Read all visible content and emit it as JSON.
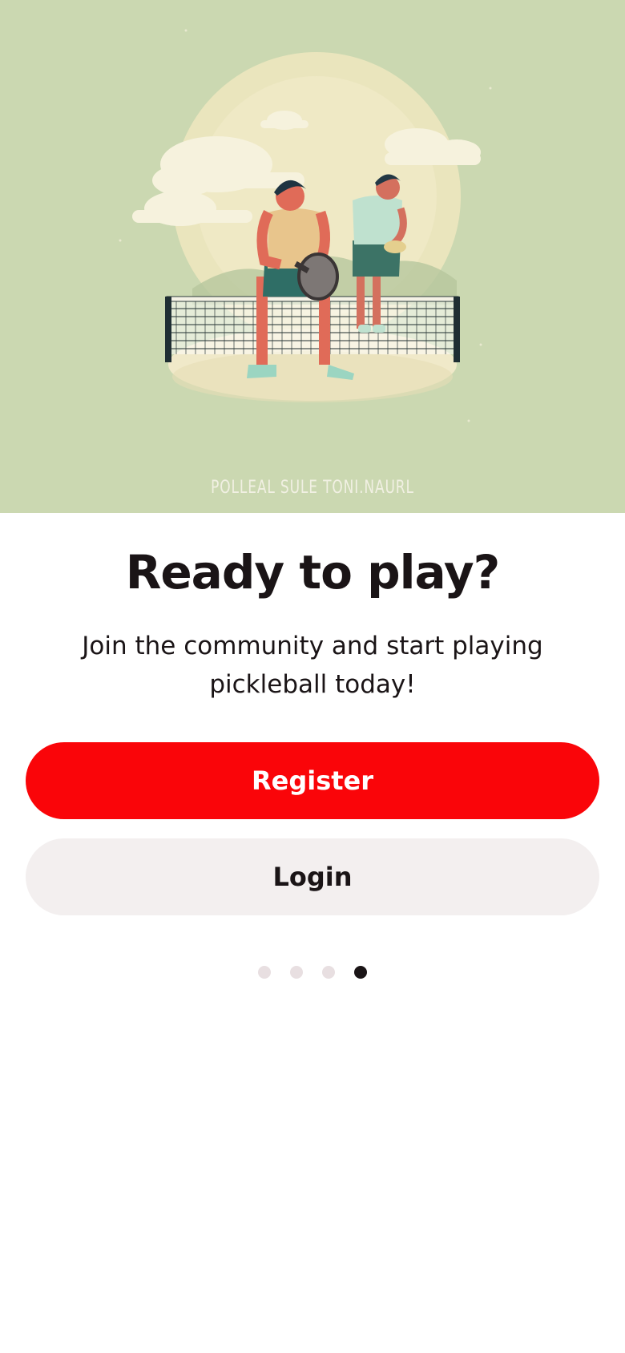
{
  "hero": {
    "caption": "POLLEAL SULE TONI.NAURL",
    "background_color": "#cbd8b1"
  },
  "onboarding": {
    "title": "Ready to play?",
    "subtitle": "Join the community and start playing pickleball today!",
    "register_label": "Register",
    "login_label": "Login",
    "page_indicator": {
      "total": 4,
      "active_index": 3
    }
  },
  "colors": {
    "primary": "#fa0509",
    "secondary_button": "#f3efef",
    "text": "#1a1416",
    "dot_inactive": "#e8dfe1"
  }
}
